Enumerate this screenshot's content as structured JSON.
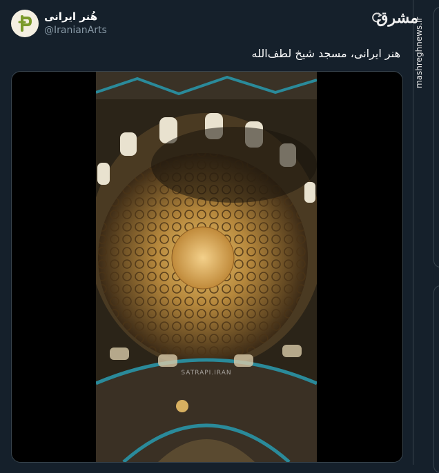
{
  "tweet": {
    "display_name": "هُنر ایرانی",
    "handle": "@IranianArts",
    "text": "هنر ایرانی، مسجد شیخ لطف‌الله",
    "media": {
      "watermark": "SATRAPI.IRAN"
    }
  },
  "site": {
    "logo": "مشرق",
    "url": "mashreghnews.ir"
  },
  "icons": {
    "refresh": "refresh-icon",
    "avatar": "iranian-arts-logo"
  },
  "colors": {
    "background": "#15202b",
    "border": "#38444d",
    "handle": "#8899a6",
    "tile_blue": "#2a8a9a",
    "dome_gold": "#c99a45"
  }
}
